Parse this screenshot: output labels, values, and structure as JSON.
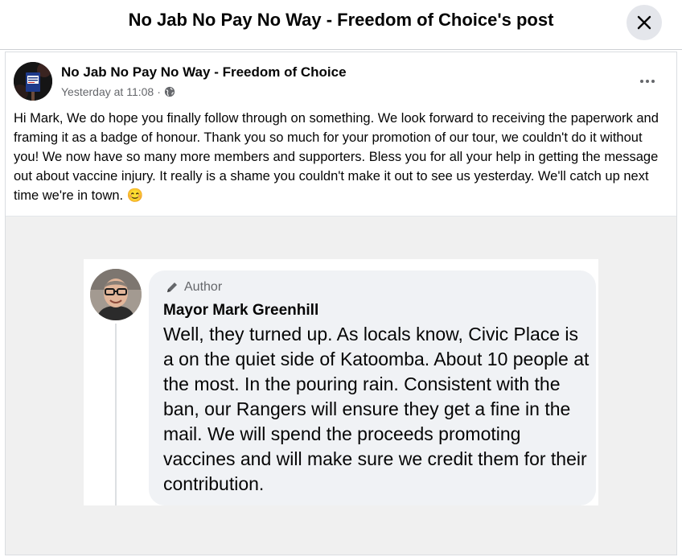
{
  "dialog": {
    "title": "No Jab No Pay No Way - Freedom of Choice's post"
  },
  "post": {
    "page_name": "No Jab No Pay No Way - Freedom of Choice",
    "timestamp": "Yesterday at 11:08",
    "separator": "·",
    "audience_icon": "globe-icon",
    "text": "Hi Mark, We do hope you finally follow through on something. We look forward to receiving the paperwork and framing it as a badge of honour. Thank you so much for your promotion of our tour, we couldn't do it without you! We now have so many more members and supporters. Bless you for all your help in getting the message out about vaccine injury. It really is a shame you couldn't make it out to see us yesterday. We'll catch up next time we're in town. 😊"
  },
  "screenshot_comment": {
    "author_badge": "Author",
    "commenter_name": "Mayor Mark Greenhill",
    "text": "Well, they turned up. As locals know, Civic Place is a on the quiet side of Katoomba. About 10 people at the most. In the pouring rain. Consistent with the ban, our Rangers will ensure they get a fine in the mail. We will spend the proceeds promoting vaccines and will make sure we credit them for their contribution."
  }
}
